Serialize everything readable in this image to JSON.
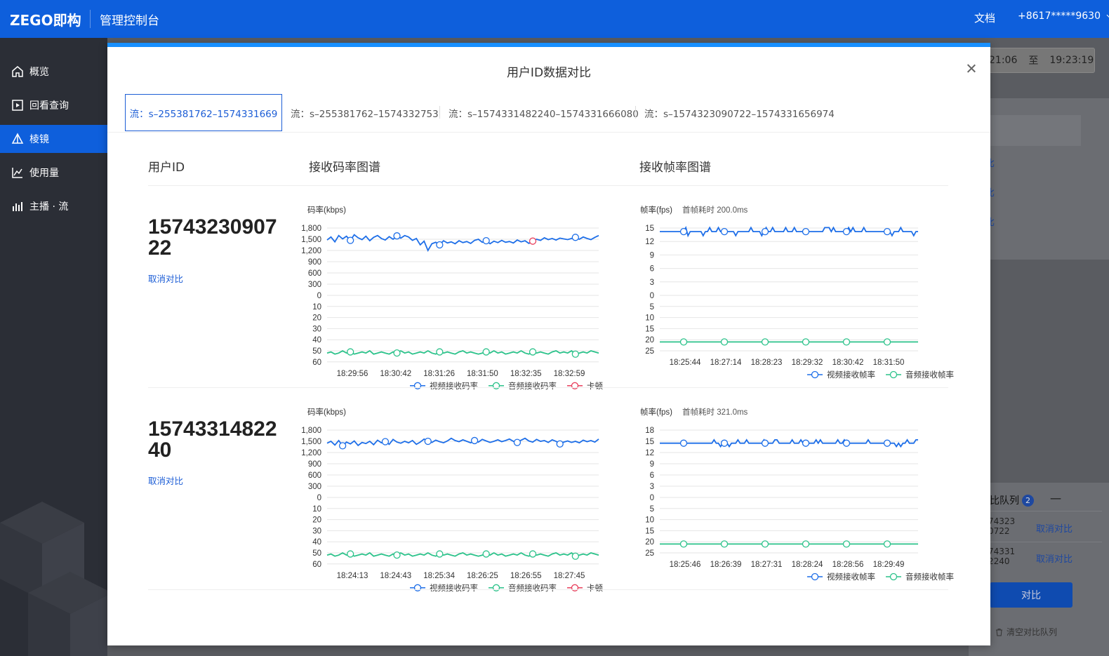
{
  "header": {
    "logo": "ZEGO即构",
    "console_title": "管理控制台",
    "docs": "文档",
    "account": "+8617*****9630"
  },
  "sidebar": {
    "items": [
      {
        "label": "概览",
        "icon": "home-icon"
      },
      {
        "label": "回看查询",
        "icon": "play-icon"
      },
      {
        "label": "棱镜",
        "icon": "prism-icon",
        "active": true
      },
      {
        "label": "使用量",
        "icon": "line-chart-icon"
      },
      {
        "label": "主播 · 流",
        "icon": "bar-chart-icon"
      }
    ]
  },
  "background": {
    "time_start": "21:06",
    "time_sep": "至",
    "time_end": "19:23:19",
    "queue": {
      "title": "比队列",
      "count": "2",
      "minimize": "一",
      "items": [
        {
          "line1": "74323",
          "line2": "0722",
          "cancel": "取消对比"
        },
        {
          "line1": "74331",
          "line2": "2240",
          "cancel": "取消对比"
        }
      ],
      "compare_button": "对比",
      "clear": "清空对比队列"
    }
  },
  "modal": {
    "title": "用户ID数据对比",
    "tabs": [
      "流：s–255381762–1574331669",
      "流：s–255381762–1574332753",
      "流：s–1574331482240–1574331666080",
      "流：s–1574323090722–1574331656974"
    ],
    "columns": {
      "user_id": "用户ID",
      "bitrate": "接收码率图谱",
      "framerate": "接收帧率图谱"
    },
    "rows": [
      {
        "user_id": "1574323090722",
        "cancel": "取消对比"
      },
      {
        "user_id": "1574331482240",
        "cancel": "取消对比"
      }
    ]
  },
  "chart_data": [
    {
      "type": "line",
      "title": "码率(kbps)",
      "upper_ticks": [
        "1,800",
        "1,500",
        "1,200",
        "900",
        "600",
        "300",
        "0"
      ],
      "lower_ticks": [
        "10",
        "20",
        "30",
        "40",
        "50",
        "60"
      ],
      "upper_ylim": [
        0,
        1800
      ],
      "lower_ylim": [
        0,
        60
      ],
      "x_ticks": [
        "18:29:56",
        "18:30:42",
        "18:31:26",
        "18:31:50",
        "18:32:35",
        "18:32:59"
      ],
      "series": [
        {
          "name": "视频接收码率",
          "color": "#1d6ee8",
          "axis": "upper",
          "values": [
            1480,
            1560,
            1430,
            1600,
            1510,
            1580,
            1470,
            1620,
            1540,
            1490,
            1580,
            1460,
            1550,
            1600,
            1520,
            1480,
            1570,
            1500,
            1590,
            1530,
            1600,
            1560,
            1470,
            1520,
            1350,
            1450,
            1200,
            1380,
            1420,
            1350,
            1460,
            1400,
            1430,
            1380,
            1460,
            1410,
            1440,
            1390,
            1470,
            1500,
            1420,
            1460,
            1380,
            1450,
            1410,
            1470,
            1420,
            1440,
            1400,
            1480,
            1430,
            1460,
            1390,
            1450,
            1500,
            1470,
            1540,
            1490,
            1520,
            1480,
            1530,
            1510,
            1490,
            1520,
            1550,
            1500,
            1560,
            1520,
            1490,
            1550,
            1600
          ]
        },
        {
          "name": "音频接收码率",
          "color": "#2bc28a",
          "axis": "lower",
          "values": [
            52,
            51,
            53,
            52,
            50,
            52,
            51,
            53,
            52,
            51,
            52,
            50,
            53,
            52,
            51,
            52,
            53,
            51,
            52,
            50,
            52,
            51,
            53,
            52,
            51,
            52,
            50,
            52,
            53,
            51,
            52,
            51,
            52,
            53,
            51,
            50,
            52,
            51,
            52,
            53,
            52,
            51,
            52,
            50,
            52,
            51,
            53,
            52,
            51,
            52,
            50,
            52,
            53,
            51,
            52,
            51,
            52,
            53,
            51,
            50,
            52,
            51,
            52,
            50,
            53,
            52,
            51,
            52,
            50,
            51,
            52
          ]
        },
        {
          "name": "卡顿",
          "color": "#e8405d",
          "axis": "upper",
          "values": []
        }
      ],
      "marker_points": [
        {
          "series": "视频接收码率",
          "x_index": 6,
          "y": 1560
        },
        {
          "series": "视频接收码率",
          "x_index": 18,
          "y": 1530
        },
        {
          "series": "视频接收码率",
          "x_index": 29,
          "y": 1400
        },
        {
          "series": "视频接收码率",
          "x_index": 41,
          "y": 1480
        },
        {
          "series": "卡顿",
          "x_index": 53,
          "y": 1420
        },
        {
          "series": "视频接收码率",
          "x_index": 64,
          "y": 1490
        }
      ]
    },
    {
      "type": "line",
      "title": "帧率(fps)",
      "subtitle": "首帧耗时 200.0ms",
      "upper_ticks": [
        "15",
        "12",
        "9",
        "6",
        "3",
        "0"
      ],
      "lower_ticks": [
        "5",
        "10",
        "15",
        "20",
        "25"
      ],
      "upper_ylim": [
        0,
        15
      ],
      "lower_ylim": [
        0,
        25
      ],
      "x_ticks": [
        "18:25:44",
        "18:27:14",
        "18:28:23",
        "18:29:32",
        "18:30:42",
        "18:31:50"
      ],
      "series": [
        {
          "name": "视频接收帧率",
          "color": "#1d6ee8",
          "axis": "upper"
        },
        {
          "name": "音频接收帧率",
          "color": "#2bc28a",
          "axis": "lower"
        }
      ],
      "baseline": {
        "video": 14.2,
        "audio": 21
      }
    },
    {
      "type": "line",
      "title": "码率(kbps)",
      "upper_ticks": [
        "1,800",
        "1,500",
        "1,200",
        "900",
        "600",
        "300",
        "0"
      ],
      "lower_ticks": [
        "10",
        "20",
        "30",
        "40",
        "50",
        "60"
      ],
      "upper_ylim": [
        0,
        1800
      ],
      "lower_ylim": [
        0,
        60
      ],
      "x_ticks": [
        "18:24:13",
        "18:24:43",
        "18:25:34",
        "18:26:25",
        "18:26:55",
        "18:27:45"
      ],
      "series": [
        {
          "name": "视频接收码率",
          "color": "#1d6ee8",
          "axis": "upper",
          "values": [
            1450,
            1500,
            1400,
            1520,
            1380,
            1480,
            1430,
            1510,
            1390,
            1470,
            1440,
            1500,
            1410,
            1530,
            1460,
            1490,
            1420,
            1550,
            1480,
            1450,
            1500,
            1460,
            1520,
            1420,
            1480,
            1560,
            1500,
            1470,
            1530,
            1490,
            1460,
            1510,
            1580,
            1520,
            1490,
            1540,
            1500,
            1460,
            1520,
            1480,
            1550,
            1510,
            1470,
            1500,
            1540,
            1490,
            1520,
            1560,
            1500,
            1470,
            1530,
            1580,
            1510,
            1480,
            1550,
            1500,
            1520,
            1470,
            1540,
            1500,
            1430,
            1480,
            1510,
            1470,
            1500,
            1460,
            1530,
            1490,
            1520,
            1480,
            1560
          ]
        },
        {
          "name": "音频接收码率",
          "color": "#2bc28a",
          "axis": "lower",
          "values": [
            52,
            51,
            53,
            52,
            50,
            52,
            51,
            53,
            52,
            51,
            52,
            50,
            53,
            52,
            51,
            52,
            53,
            51,
            52,
            50,
            52,
            51,
            53,
            52,
            51,
            52,
            50,
            52,
            53,
            51,
            52,
            51,
            52,
            53,
            51,
            50,
            52,
            51,
            52,
            53,
            52,
            51,
            52,
            50,
            52,
            51,
            53,
            52,
            51,
            52,
            50,
            52,
            53,
            51,
            52,
            51,
            52,
            53,
            51,
            50,
            52,
            51,
            52,
            50,
            53,
            52,
            51,
            52,
            50,
            51,
            52
          ]
        },
        {
          "name": "卡顿",
          "color": "#e8405d",
          "axis": "lower",
          "values": []
        }
      ],
      "marker_points": [
        {
          "series": "视频接收码率",
          "x_index": 4,
          "y": 1380
        },
        {
          "series": "视频接收码率",
          "x_index": 15,
          "y": 1490
        },
        {
          "series": "视频接收码率",
          "x_index": 26,
          "y": 1500
        },
        {
          "series": "视频接收码率",
          "x_index": 38,
          "y": 1520
        },
        {
          "series": "视频接收码率",
          "x_index": 49,
          "y": 1470
        },
        {
          "series": "视频接收码率",
          "x_index": 60,
          "y": 1430
        }
      ],
      "stall_marker": {
        "x_index": 26,
        "axis": "lower",
        "y": 51
      }
    },
    {
      "type": "line",
      "title": "帧率(fps)",
      "subtitle": "首帧耗时 321.0ms",
      "upper_ticks": [
        "18",
        "15",
        "12",
        "9",
        "6",
        "3",
        "0"
      ],
      "lower_ticks": [
        "5",
        "10",
        "15",
        "20",
        "25"
      ],
      "upper_ylim": [
        0,
        18
      ],
      "lower_ylim": [
        0,
        25
      ],
      "x_ticks": [
        "18:25:46",
        "18:26:39",
        "18:27:31",
        "18:28:24",
        "18:28:56",
        "18:29:49"
      ],
      "series": [
        {
          "name": "视频接收帧率",
          "color": "#1d6ee8",
          "axis": "upper"
        },
        {
          "name": "音频接收帧率",
          "color": "#2bc28a",
          "axis": "lower"
        }
      ],
      "baseline": {
        "video": 14.5,
        "audio": 21
      }
    }
  ],
  "colors": {
    "brand_blue": "#0e5fdc",
    "link_blue": "#1d5ed6",
    "sidebar_bg": "#2b2e36",
    "modal_top_border": "#1890ff"
  }
}
